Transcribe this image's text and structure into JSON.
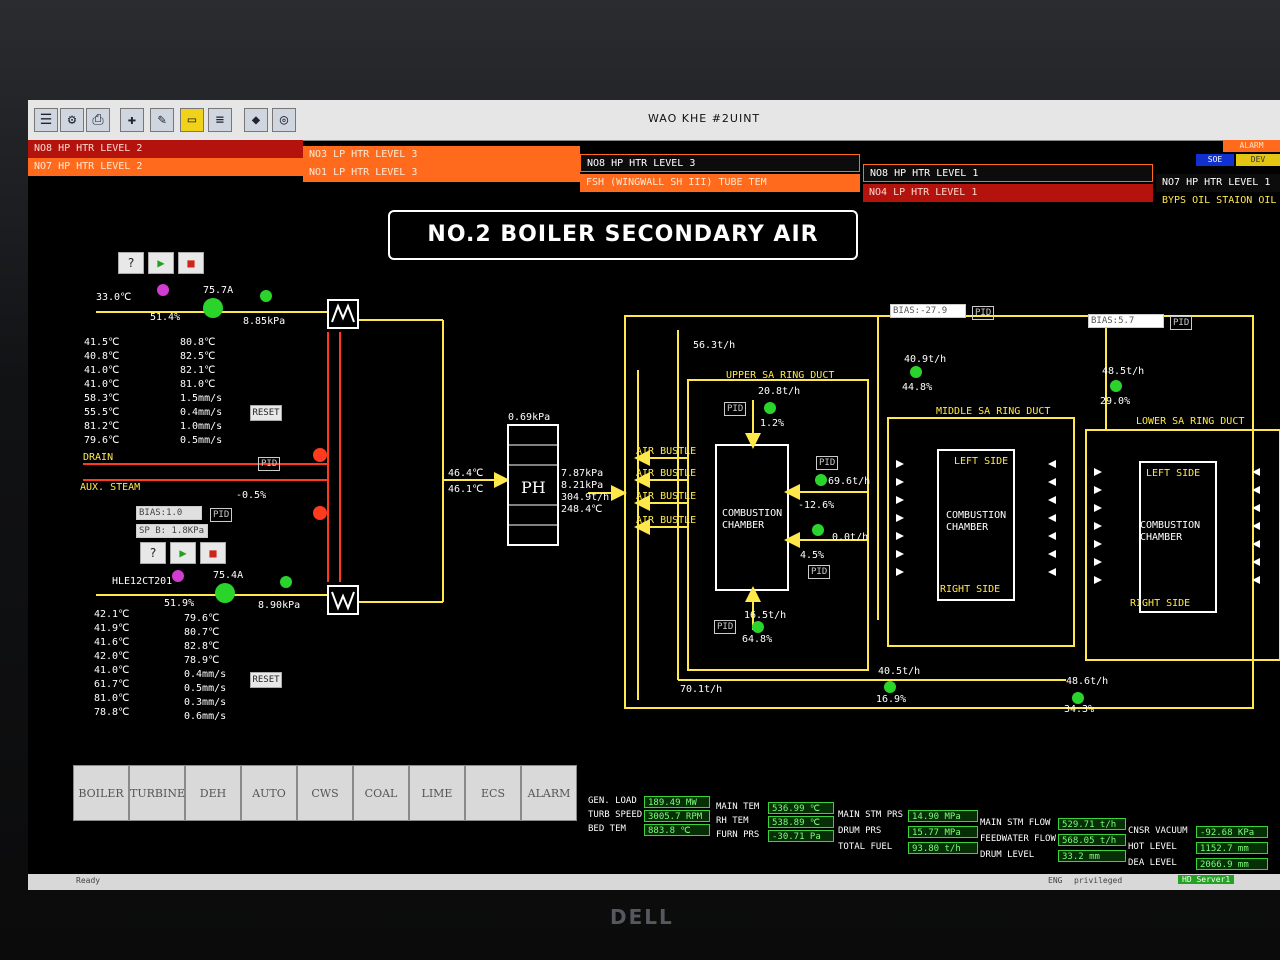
{
  "window": {
    "title": "WAO KHE  #2UINT"
  },
  "toolbar_icons": [
    "menu-icon",
    "share-icon",
    "print-icon",
    "pin-icon",
    "note-icon",
    "folder-icon",
    "tools-icon",
    "drive-icon",
    "settings-icon"
  ],
  "alarm_banner": {
    "col1": [
      "NO8 HP HTR LEVEL 2",
      "NO7 HP HTR LEVEL 2"
    ],
    "col2": [
      "NO3 LP HTR LEVEL 3",
      "NO1 LP HTR LEVEL 3"
    ],
    "col3": [
      "NO8 HP HTR LEVEL 3",
      "FSH (WINGWALL SH III) TUBE TEM"
    ],
    "col4": [
      "NO8 HP HTR LEVEL 1",
      "NO4 LP HTR LEVEL 1"
    ],
    "col5": [
      "NO7 HP HTR LEVEL 1",
      "BYPS OIL STAION OIL"
    ],
    "alarm_label": "ALARM",
    "soe_label": "SOE",
    "dev_label": "DEV"
  },
  "title": "NO.2 BOILER SECONDARY AIR",
  "fan_a": {
    "controls": [
      "?",
      "▶",
      "■"
    ],
    "tag": "33.0℃",
    "damper_pos": "51.4%",
    "current": "75.7A",
    "pressure": "8.85kPa",
    "temps_left": [
      "41.5℃",
      "40.8℃",
      "41.0℃",
      "41.0℃",
      "58.3℃",
      "55.5℃",
      "81.2℃",
      "79.6℃"
    ],
    "temps_right": [
      "80.8℃",
      "82.5℃",
      "82.1℃",
      "81.0℃",
      "1.5mm/s",
      "0.4mm/s",
      "1.0mm/s",
      "0.5mm/s"
    ],
    "reset": "RESET"
  },
  "fan_b": {
    "controls": [
      "?",
      "▶",
      "■"
    ],
    "tag": "HLE12CT201",
    "damper_pos": "51.9%",
    "current": "75.4A",
    "pressure": "8.90kPa",
    "temps_left": [
      "42.1℃",
      "41.9℃",
      "41.6℃",
      "42.0℃",
      "41.0℃",
      "61.7℃",
      "81.0℃",
      "78.8℃"
    ],
    "temps_right": [
      "79.6℃",
      "80.7℃",
      "82.8℃",
      "78.9℃",
      "0.4mm/s",
      "0.5mm/s",
      "0.3mm/s",
      "0.6mm/s"
    ],
    "reset": "RESET"
  },
  "steam": {
    "drain": "DRAIN",
    "aux_steam": "AUX. STEAM",
    "valve_pos": "-0.5%",
    "pid": "PID",
    "bias": "BIAS:1.0",
    "bias_unit": "%",
    "sp": "SP B: 1.8KPa"
  },
  "ph": {
    "label": "PH",
    "in_temp_1": "46.4℃",
    "in_temp_2": "46.1℃",
    "dp": "0.69kPa",
    "p1": "7.87kPa",
    "p2": "8.21kPa",
    "flow": "304.9t/h",
    "out_temp": "248.4℃"
  },
  "air_bustle": [
    "AIR BUSTLE",
    "AIR BUSTLE",
    "AIR BUSTLE",
    "AIR BUSTLE"
  ],
  "upper": {
    "main_flow": "56.3t/h",
    "label": "UPPER SA RING DUCT",
    "flow": "20.8t/h",
    "pos": "1.2%",
    "chamber": [
      "COMBUSTION",
      "CHAMBER"
    ],
    "right_flow_1": "69.6t/h",
    "right_pos_1": "-12.6%",
    "right_flow_2": "0.0t/h",
    "right_pos_2": "4.5%",
    "bottom_flow": "16.5t/h",
    "bottom_pos": "64.8%",
    "total_flow": "70.1t/h"
  },
  "middle": {
    "bias": "BIAS:-27.9",
    "bias_unit": "%",
    "flow": "40.9t/h",
    "pos": "44.8%",
    "label": "MIDDLE SA RING DUCT",
    "left_side": "LEFT SIDE",
    "right_side": "RIGHT SIDE",
    "chamber": [
      "COMBUSTION",
      "CHAMBER"
    ],
    "bottom_flow": "40.5t/h",
    "bottom_pos": "16.9%"
  },
  "lower": {
    "bias": "BIAS:5.7",
    "bias_unit": "%",
    "flow": "48.5t/h",
    "pos": "29.0%",
    "label": "LOWER SA RING DUCT",
    "left_side": "LEFT SIDE",
    "right_side": "RIGHT SIDE",
    "chamber": [
      "COMBUSTION",
      "CHAMBER"
    ],
    "bottom_flow": "48.6t/h",
    "bottom_pos": "34.3%"
  },
  "nav": [
    "BOILER",
    "TURBINE",
    "DEH",
    "AUTO",
    "CWS",
    "COAL",
    "LIME",
    "ECS",
    "ALARM"
  ],
  "status": {
    "gen_load_label": "GEN. LOAD",
    "gen_load": "189.49 MW",
    "turb_speed_label": "TURB SPEED",
    "turb_speed": "3005.7 RPM",
    "bed_tem_label": "BED TEM",
    "bed_tem": "883.8 ℃",
    "main_tem_label": "MAIN TEM",
    "main_tem": "536.99 ℃",
    "rh_tem_label": "RH TEM",
    "rh_tem": "538.89 ℃",
    "furn_prs_label": "FURN PRS",
    "furn_prs": "-30.71 Pa",
    "main_stm_prs_label": "MAIN STM PRS",
    "main_stm_prs": "14.90 MPa",
    "drum_prs_label": "DRUM PRS",
    "drum_prs": "15.77 MPa",
    "total_fuel_label": "TOTAL FUEL",
    "total_fuel": "93.80 t/h",
    "main_stm_flow_label": "MAIN STM FLOW",
    "main_stm_flow": "529.71 t/h",
    "feedwater_flow_label": "FEEDWATER FLOW",
    "feedwater_flow": "568.05 t/h",
    "drum_level_label": "DRUM LEVEL",
    "drum_level": "33.2 mm",
    "cnsr_vacuum_label": "CNSR VACUUM",
    "cnsr_vacuum": "-92.68 KPa",
    "hot_level_label": "HOT LEVEL",
    "hot_level": "1152.7 mm",
    "dea_level_label": "DEA LEVEL",
    "dea_level": "2066.9 mm"
  },
  "statusbar": {
    "ready": "Ready",
    "lang": "ENG",
    "priv": "privileged",
    "server": "HD Server1"
  },
  "monitor_brand": "DELL",
  "colors": {
    "flow_line": "#ffe94a",
    "steam_line": "#ff3b1f",
    "running_green": "#2bd42b",
    "motor_magenta": "#d13cd1"
  }
}
